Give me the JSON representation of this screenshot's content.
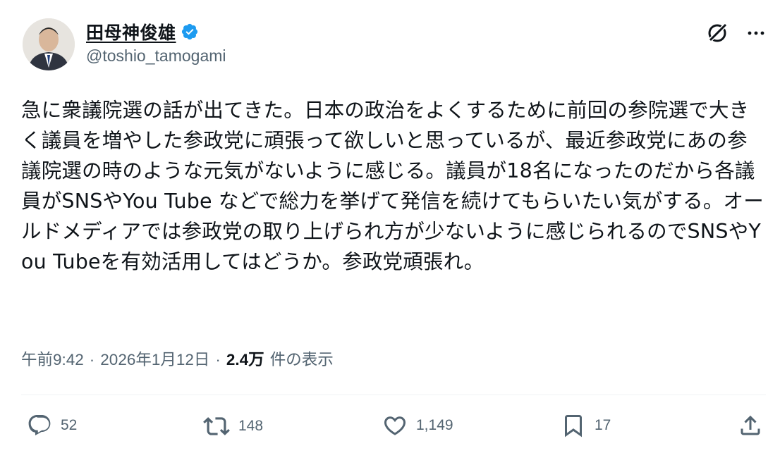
{
  "author": {
    "display_name": "田母神俊雄",
    "handle": "@toshio_tamogami",
    "verified": true
  },
  "post": {
    "text": "急に衆議院選の話が出てきた。日本の政治をよくするために前回の参院選で大きく議員を増やした参政党に頑張って欲しいと思っているが、最近参政党にあの参議院選の時のような元気がないように感じる。議員が18名になったのだから各議員がSNSやYou Tube などで総力を挙げて発信を続けてもらいたい気がする。オールドメディアでは参政党の取り上げられ方が少ないように感じられるのでSNSやYou Tubeを有効活用してはどうか。参政党頑張れ。",
    "time": "午前9:42",
    "date": "2026年1月12日",
    "views_count": "2.4万",
    "views_label": "件の表示",
    "separator": "·"
  },
  "actions": {
    "reply_count": "52",
    "repost_count": "148",
    "like_count": "1,149",
    "bookmark_count": "17"
  },
  "icons": {
    "verified": "verified-badge-icon",
    "grok": "grok-icon",
    "more": "more-icon",
    "reply": "reply-icon",
    "repost": "repost-icon",
    "like": "like-icon",
    "bookmark": "bookmark-icon",
    "share": "share-icon"
  },
  "colors": {
    "text_primary": "#0f1419",
    "text_secondary": "#536471",
    "verified_blue": "#1d9bf0",
    "divider": "#eff3f4"
  }
}
